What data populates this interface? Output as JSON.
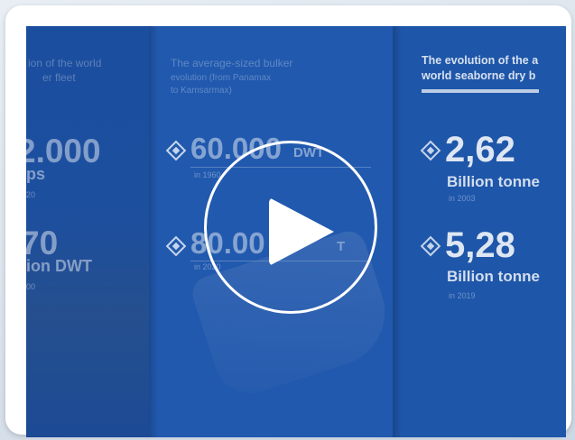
{
  "video": {
    "col_a": {
      "faint_line1": "ion of the world",
      "faint_line2": "er fleet",
      "big1": "2.000",
      "sub1": "ps",
      "tiny1": "20",
      "big2": "70",
      "sub2": "ion DWT",
      "tiny2": "00"
    },
    "col_b": {
      "faint_line1": "The average-sized bulker",
      "faint_line2": "evolution (from Panamax",
      "faint_line3": "to Kamsarmax)",
      "big1": "60.000",
      "unit1": "DWT",
      "tiny1": "in 1960",
      "big2": "80.00",
      "unit2": "T",
      "tiny2": "in 2020"
    },
    "col_c": {
      "title_line1": "The evolution of the a",
      "title_line2": "world seaborne dry b",
      "big1": "2,62",
      "sub1": "Billion tonne",
      "tiny1": "in 2003",
      "big2": "5,28",
      "sub2": "Billion tonne",
      "tiny2": "in 2019"
    }
  },
  "player": {
    "play_icon": "play-icon"
  },
  "colors": {
    "video_bg": "#1f55a8",
    "card_bg": "#ffffff",
    "play": "#ffffff"
  }
}
